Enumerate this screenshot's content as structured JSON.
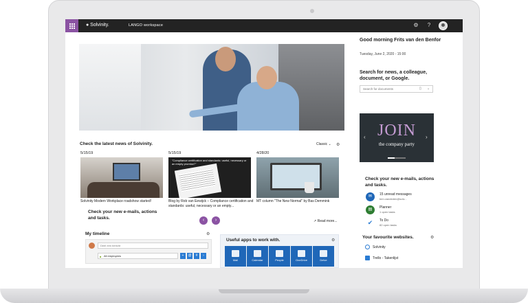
{
  "topbar": {
    "brand": "● Solvinity.",
    "workspace": "LANGO workspace",
    "settings_icon": "gear-icon",
    "help_icon": "question-icon"
  },
  "greeting": {
    "title": "Good morning Frits van den Benfor",
    "date": "Tuesday, June 2, 2020 - 15:00"
  },
  "search": {
    "label": "Search for news, a colleague, document, or Google.",
    "placeholder": "Search for documents"
  },
  "banner": {
    "headline": "JOIN",
    "subtitle": "the company party"
  },
  "news": {
    "title": "Check the latest news of Solvinity.",
    "view": "Classic",
    "items": [
      {
        "date": "5/15/19",
        "caption": "Solvinity Modern Workplace roadshow started!"
      },
      {
        "date": "5/15/19",
        "caption": "Blog by Rob van Eewijck – Compliance certification and standards: useful, necessary or an empty...",
        "image_text": "\"Compliance certification and standards: useful, necessary or an empty promise?\""
      },
      {
        "date": "4/28/20",
        "caption": "MT column \"The New Normal\" by Bas Demmink"
      }
    ],
    "read_more": "Read more..."
  },
  "email_promo": "Check your new e-mails, actions and tasks.",
  "timeline": {
    "title": "My timeline",
    "input_placeholder": "Deel een bericht",
    "audience": "All employees"
  },
  "apps": {
    "title": "Useful apps to work with.",
    "items": [
      "Mail",
      "Calendar",
      "People",
      "OneDrive",
      "Delve"
    ]
  },
  "mail": {
    "title": "Check your new e-mails, actions and tasks.",
    "items": [
      {
        "name": "15 unread messages",
        "sub": "ben.vandeden@solv...",
        "color": "#1f67b8"
      },
      {
        "name": "Planner",
        "sub": "1 open tasks",
        "color": "#2e7d32"
      },
      {
        "name": "To Do",
        "sub": "82 open tasks",
        "color": "#2b7cd3"
      }
    ]
  },
  "favourites": {
    "title": "Your favourite websites.",
    "items": [
      "Solvinity",
      "Trello - Takenlijst"
    ]
  },
  "colors": {
    "accent": "#8b53a3",
    "topbar": "#232323",
    "app_blue": "#1f67b8"
  }
}
